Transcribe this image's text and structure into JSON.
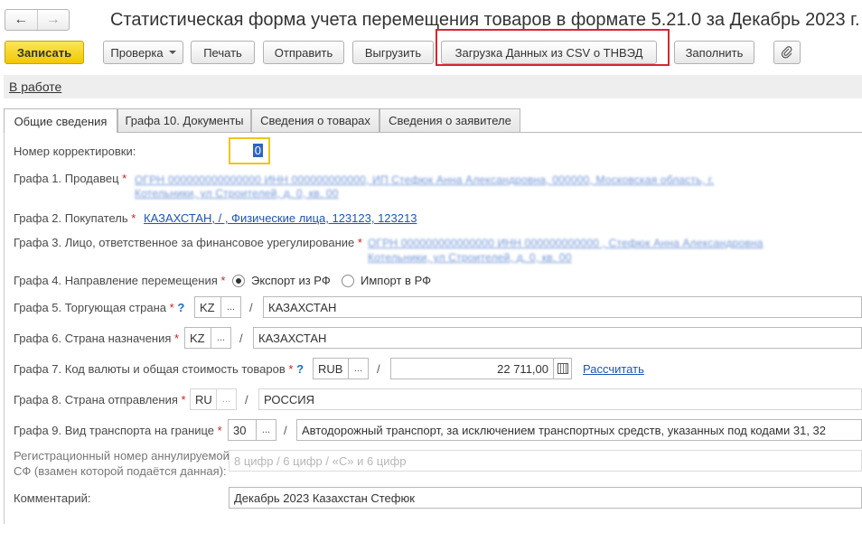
{
  "nav": {
    "back_icon": "arrow-left-icon",
    "forward_icon": "arrow-right-icon"
  },
  "window": {
    "title": "Статистическая форма учета перемещения товаров в формате 5.21.0 за Декабрь 2023 г."
  },
  "toolbar": {
    "save_label": "Записать",
    "check_label": "Проверка",
    "print_label": "Печать",
    "send_label": "Отправить",
    "export_label": "Выгрузить",
    "load_csv_label": "Загрузка Данных из CSV о ТНВЭД",
    "fill_label": "Заполнить",
    "attach_icon": "paperclip-icon"
  },
  "status": {
    "label": "В работе"
  },
  "tabs": [
    {
      "label": "Общие сведения"
    },
    {
      "label": "Графа 10. Документы"
    },
    {
      "label": "Сведения о товарах"
    },
    {
      "label": "Сведения о заявителе"
    }
  ],
  "form": {
    "correction_label": "Номер корректировки:",
    "correction_value": "0",
    "seller_label": "Графа 1. Продавец",
    "seller_line1": "ОГРН 000000000000000 ИНН 000000000000, ИП Стефюк Анна Александровна, 000000, Московская область, г.",
    "seller_line2": "Котельники, ул Строителей, д. 0, кв. 00",
    "buyer_label": "Графа 2. Покупатель",
    "buyer_value": "КАЗАХСТАН, / , Физические лица, 123123, 123213",
    "responsible_label": "Графа 3. Лицо, ответственное за финансовое урегулирование",
    "responsible_line1": "ОГРН 000000000000000 ИНН 000000000000 , Стефюк Анна Александровна",
    "responsible_line2": "Котельники, ул Строителей, д. 0, кв. 00",
    "direction_label": "Графа 4. Направление перемещения",
    "direction_export": "Экспорт из РФ",
    "direction_import": "Импорт в РФ",
    "trade_country_label": "Графа 5. Торгующая страна",
    "trade_country_code": "KZ",
    "trade_country_name": "КАЗАХСТАН",
    "dest_country_label": "Графа 6. Страна назначения",
    "dest_country_code": "KZ",
    "dest_country_name": "КАЗАХСТАН",
    "currency_label": "Графа 7. Код валюты и общая стоимость товаров",
    "currency_code": "RUB",
    "currency_amount": "22 711,00",
    "calculate_label": "Рассчитать",
    "origin_country_label": "Графа 8. Страна отправления",
    "origin_country_code": "RU",
    "origin_country_name": "РОССИЯ",
    "transport_label": "Графа 9. Вид транспорта на границе",
    "transport_code": "30",
    "transport_name": "Автодорожный транспорт, за исключением транспортных средств, указанных под кодами 31, 32",
    "reg_label_line1": "Регистрационный номер аннулируемой",
    "reg_label_line2": "СФ (взамен которой подаётся данная):",
    "reg_placeholder": "8 цифр / 6 цифр / «С» и 6 цифр",
    "comment_label": "Комментарий:",
    "comment_value": "Декабрь 2023 Казахстан Стефюк",
    "required_mark": "*",
    "help_mark": "?",
    "slash": "/",
    "dots": "..."
  }
}
